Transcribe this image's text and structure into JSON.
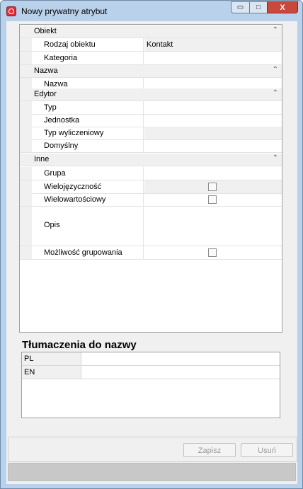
{
  "window": {
    "title": "Nowy prywatny atrybut",
    "controls": {
      "minimize": "▭",
      "maximize": "□",
      "close": "X"
    }
  },
  "grid": {
    "categories": [
      {
        "label": "Obiekt",
        "rows": [
          {
            "name": "Rodzaj obiektu",
            "value": "Kontakt"
          },
          {
            "name": "Kategoria",
            "value": ""
          }
        ]
      },
      {
        "label": "Nazwa",
        "rows": [
          {
            "name": "Nazwa",
            "value": ""
          }
        ]
      },
      {
        "label": "Edytor",
        "rows": [
          {
            "name": "Typ",
            "value": ""
          },
          {
            "name": "Jednostka",
            "value": ""
          },
          {
            "name": "Typ wyliczeniowy",
            "value": ""
          },
          {
            "name": "Domyślny",
            "value": ""
          }
        ]
      },
      {
        "label": "Inne",
        "rows": [
          {
            "name": "Grupa",
            "value": ""
          },
          {
            "name": "Wielojęzyczność",
            "checked": false
          },
          {
            "name": "Wielowartościowy",
            "checked": false
          },
          {
            "name": "Opis",
            "value": ""
          },
          {
            "name": "Możliwość grupowania",
            "checked": false
          }
        ]
      }
    ]
  },
  "translations": {
    "title": "Tłumaczenia do nazwy",
    "rows": [
      {
        "lang": "PL",
        "value": ""
      },
      {
        "lang": "EN",
        "value": ""
      }
    ]
  },
  "buttons": {
    "save": "Zapisz",
    "delete": "Usuń"
  },
  "colors": {
    "title_bar": "#b9d1ea",
    "close_button": "#c9483c",
    "disabled_text": "#9a9a9a"
  }
}
